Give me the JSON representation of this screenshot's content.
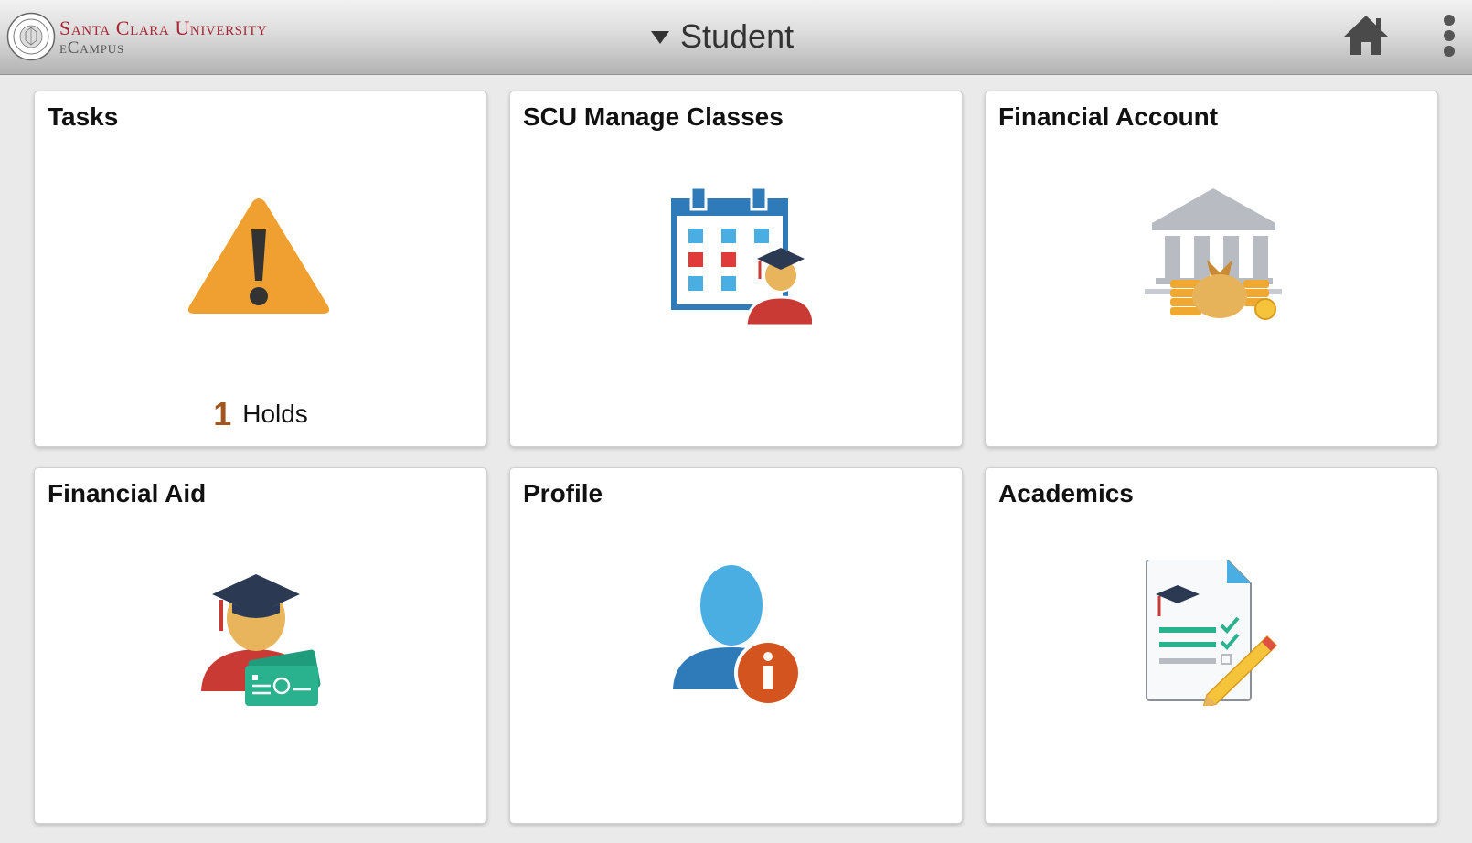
{
  "header": {
    "brand_name": "Santa Clara University",
    "brand_sub": "eCampus",
    "nav_title": "Student"
  },
  "tiles": [
    {
      "title": "Tasks",
      "icon": "warning-icon",
      "badge": {
        "count": "1",
        "label": "Holds"
      }
    },
    {
      "title": "SCU Manage Classes",
      "icon": "calendar-student-icon"
    },
    {
      "title": "Financial Account",
      "icon": "bank-money-icon"
    },
    {
      "title": "Financial Aid",
      "icon": "graduate-money-icon"
    },
    {
      "title": "Profile",
      "icon": "profile-info-icon"
    },
    {
      "title": "Academics",
      "icon": "document-checklist-icon"
    }
  ],
  "colors": {
    "brand_red": "#a52532",
    "warning_orange": "#f0a030",
    "holds_brown": "#a0561e",
    "calendar_blue": "#2f7ab8",
    "profile_blue": "#4aaee3",
    "info_orange": "#d4541f",
    "green": "#2ab28f"
  }
}
